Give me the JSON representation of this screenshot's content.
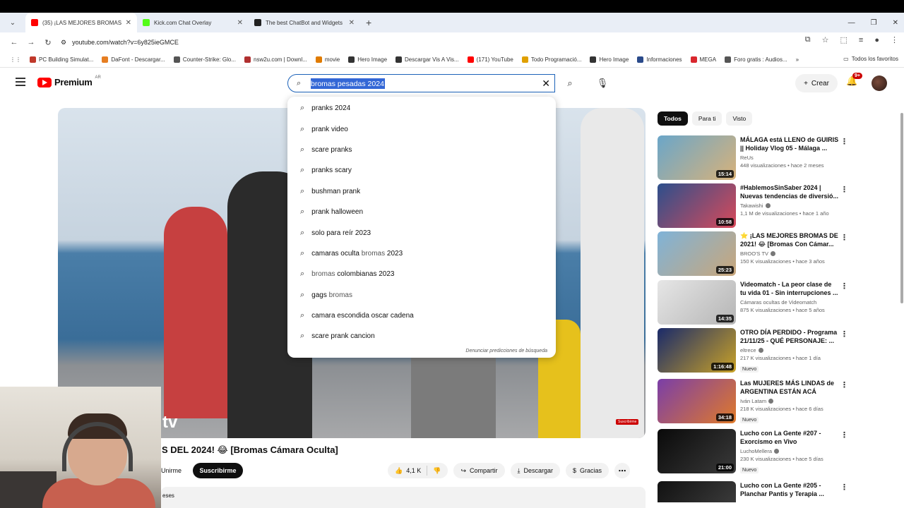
{
  "browser": {
    "tabs": [
      {
        "title": "(35) ¡LAS MEJORES BROMAS D",
        "color": "#ff0000",
        "active": true
      },
      {
        "title": "Kick.com Chat Overlay",
        "color": "#53fc18",
        "active": false
      },
      {
        "title": "The best ChatBot and Widgets",
        "color": "#222222",
        "active": false
      }
    ],
    "url": "youtube.com/watch?v=6y825ieGMCE",
    "bookmarks": [
      {
        "label": "PC Building Simulat...",
        "color": "#c0392b"
      },
      {
        "label": "DaFont - Descargar...",
        "color": "#e67e22"
      },
      {
        "label": "Counter-Strike: Glo...",
        "color": "#555555"
      },
      {
        "label": "nsw2u.com | Downl...",
        "color": "#b03030"
      },
      {
        "label": "movie",
        "color": "#e07b00"
      },
      {
        "label": "Hero Image",
        "color": "#333333"
      },
      {
        "label": "Descargar Vis A Vis...",
        "color": "#333333"
      },
      {
        "label": "(171) YouTube",
        "color": "#ff0000"
      },
      {
        "label": "Todo Programació...",
        "color": "#e0a000"
      },
      {
        "label": "Hero Image",
        "color": "#333333"
      },
      {
        "label": "Informaciones",
        "color": "#2a4a8a"
      },
      {
        "label": "MEGA",
        "color": "#d9272e"
      },
      {
        "label": "Foro gratis : Audios...",
        "color": "#555555"
      }
    ],
    "all_bookmarks": "Todos los favoritos"
  },
  "header": {
    "logo": "Premium",
    "country": "AR",
    "search_value": "bromas pesadas 2024",
    "create_label": "Crear",
    "notifications": "9+"
  },
  "suggestions": [
    {
      "text": "pranks 2024"
    },
    {
      "text": "prank video"
    },
    {
      "text": "scare pranks"
    },
    {
      "text": "pranks scary"
    },
    {
      "text": "bushman prank"
    },
    {
      "text": "prank halloween"
    },
    {
      "text": "solo para reír 2023"
    },
    {
      "bold": "camaras oculta ",
      "plain": "bromas",
      "after": " 2023"
    },
    {
      "plain": "bromas",
      "after": " colombianas 2023"
    },
    {
      "bold": "gags ",
      "plain": "bromas",
      "after": ""
    },
    {
      "text": "camara escondida oscar cadena"
    },
    {
      "text": "scare prank cancion"
    }
  ],
  "report_label": "Denunciar predicciones de búsqueda",
  "video": {
    "watermark": "tv",
    "mini_subscribe": "Suscribirme",
    "title": "S DEL 2024! 😂 [Bromas Cámara Oculta]",
    "join_label": "Unirme",
    "subscribe_label": "Suscribirme",
    "likes": "4,1 K",
    "share_label": "Compartir",
    "download_label": "Descargar",
    "thanks_label": "Gracias",
    "desc_fragment": "eses"
  },
  "chips": [
    "Todos",
    "Para ti",
    "Visto"
  ],
  "recommendations": [
    {
      "title": "MÁLAGA está LLENO de GUIRIS || Holiday Vlog 05 - Málaga ...",
      "channel": "ReUs",
      "verified": false,
      "meta": "448 visualizaciones • hace 2 meses",
      "duration": "15:14",
      "new": "",
      "c1": "#6aa6c9",
      "c2": "#d8b27a"
    },
    {
      "title": "#HablemosSinSaber 2024 | Nuevas tendencias de diversió...",
      "channel": "Takawishi",
      "verified": true,
      "meta": "1,1 M de visualizaciones • hace 1 año",
      "duration": "10:58",
      "new": "",
      "c1": "#2c4f8c",
      "c2": "#d94a5a"
    },
    {
      "title": "⭐ ¡LAS MEJORES BROMAS DE 2021! 😂 [Bromas Con Cámar...",
      "channel": "BROO'S TV",
      "verified": true,
      "meta": "150 K visualizaciones • hace 3 años",
      "duration": "25:23",
      "new": "",
      "c1": "#7fb3d8",
      "c2": "#c9a67a"
    },
    {
      "title": "Videomatch - La peor clase de tu vida 01 - Sin interrupciones ...",
      "channel": "Cámaras ocultas de Videomatch",
      "verified": false,
      "meta": "875 K visualizaciones • hace 5 años",
      "duration": "14:35",
      "new": "",
      "c1": "#e6e6e6",
      "c2": "#b5b5b5"
    },
    {
      "title": "OTRO DÍA PERDIDO - Programa 21/11/25 - QUÉ PERSONAJE: ...",
      "channel": "eltrece",
      "verified": true,
      "meta": "217 K visualizaciones • hace 1 día",
      "duration": "1:16:48",
      "new": "Nuevo",
      "c1": "#1a2a6a",
      "c2": "#c9a227"
    },
    {
      "title": "Las MUJERES MÁS LINDAS de ARGENTINA ESTÁN ACÁ",
      "channel": "Iván Latam",
      "verified": true,
      "meta": "218 K visualizaciones • hace 6 días",
      "duration": "34:18",
      "new": "Nuevo",
      "c1": "#7a3ea8",
      "c2": "#e07a2a"
    },
    {
      "title": "Lucho con La Gente #207 - Exorcismo en Vivo",
      "channel": "LuchoMellera",
      "verified": true,
      "meta": "230 K visualizaciones • hace 5 días",
      "duration": "21:00",
      "new": "Nuevo",
      "c1": "#0a0a0a",
      "c2": "#3a3a3a"
    },
    {
      "title": "Lucho con La Gente #205 - Planchar Pantis y Terapia ...",
      "channel": "",
      "verified": false,
      "meta": "",
      "duration": "",
      "new": "",
      "c1": "#111111",
      "c2": "#444444"
    }
  ]
}
